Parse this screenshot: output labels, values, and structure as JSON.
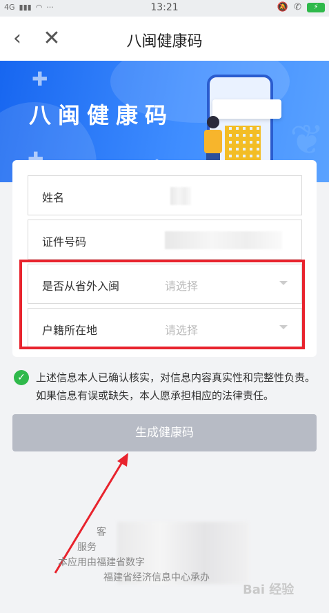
{
  "status_bar": {
    "network": "4G",
    "time": "13:21",
    "battery_symbol": "⚡"
  },
  "nav": {
    "title": "八闽健康码"
  },
  "banner": {
    "title": "八闽健康码"
  },
  "form": {
    "fields": [
      {
        "label": "姓名"
      },
      {
        "label": "证件号码"
      },
      {
        "label": "是否从省外入闽",
        "placeholder": "请选择"
      },
      {
        "label": "户籍所在地",
        "placeholder": "请选择"
      }
    ]
  },
  "consent": {
    "text": "上述信息本人已确认核实，对信息内容真实性和完整性负责。如果信息有误或缺失，本人愿承担相应的法律责任。"
  },
  "button": {
    "label": "生成健康码"
  },
  "footer": {
    "line1": "客",
    "line2": "服务",
    "line3": "本应用由福建省数字",
    "line4": "福建省经济信息中心承办"
  },
  "watermark": "Bai 经验",
  "colors": {
    "accent": "#1766f0",
    "success": "#2fb94b",
    "annotation": "#e8232d",
    "button_disabled": "#b7bbc5"
  }
}
